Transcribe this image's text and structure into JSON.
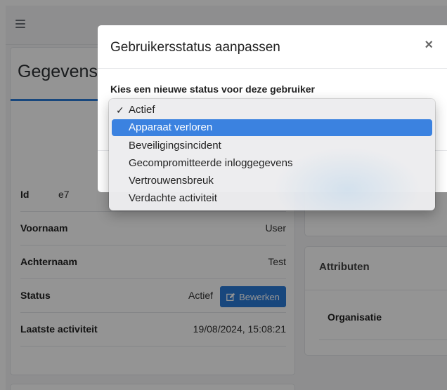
{
  "page": {
    "card_title": "Gegevens",
    "rows": [
      {
        "label": "Id",
        "value": "e7"
      },
      {
        "label": "Voornaam",
        "value": "User"
      },
      {
        "label": "Achternaam",
        "value": "Test"
      },
      {
        "label": "Status",
        "value": "Actief"
      },
      {
        "label": "Laatste activiteit",
        "value": "19/08/2024, 15:08:21"
      }
    ],
    "edit_button": "Bewerken",
    "attributes_title": "Attributen",
    "organisation_label": "Organisatie"
  },
  "modal": {
    "title": "Gebruikersstatus aanpassen",
    "close": "×",
    "label": "Kies een nieuwe status voor deze gebruiker"
  },
  "dropdown": {
    "checkmark": "✓",
    "checked_index": 0,
    "highlighted_index": 1,
    "options": [
      "Actief",
      "Apparaat verloren",
      "Beveiligingsincident",
      "Gecompromitteerde inloggegevens",
      "Vertrouwensbreuk",
      "Verdachte activiteit"
    ]
  },
  "colors": {
    "accent": "#2a7ad8",
    "highlight": "#3b82e0"
  }
}
